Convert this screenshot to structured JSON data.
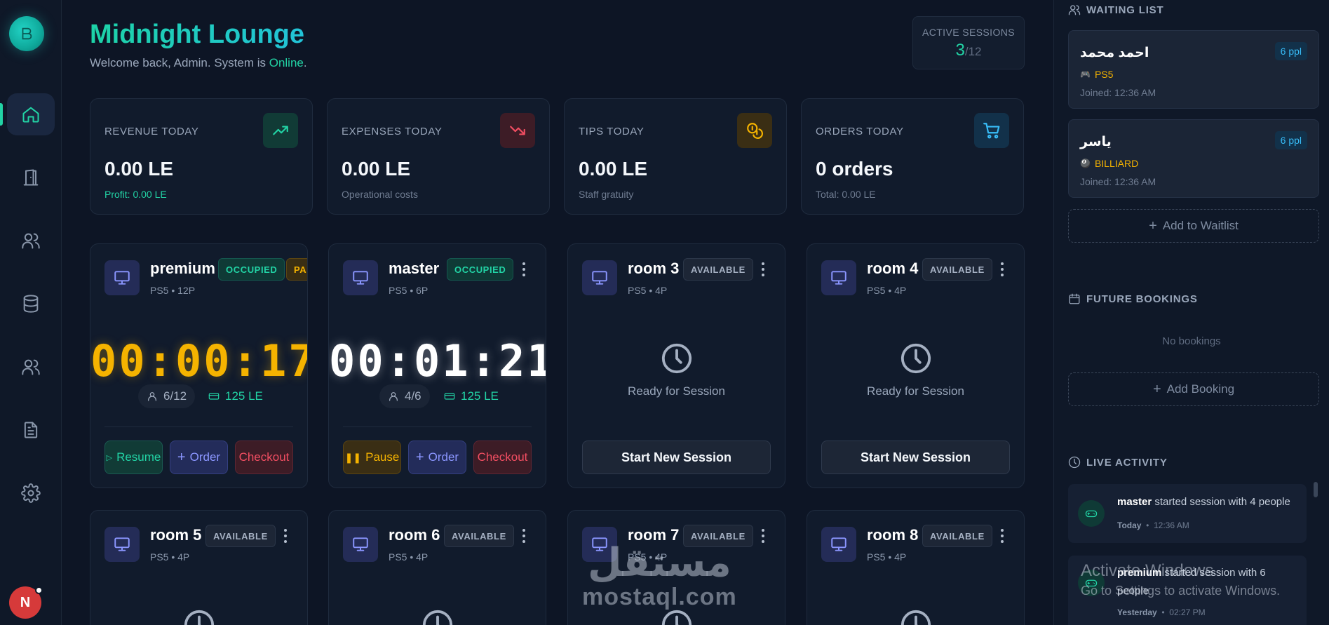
{
  "app": {
    "title": "Midnight Lounge",
    "welcome_prefix": "Welcome back, Admin. System is ",
    "status": "Online",
    "status_suffix": "."
  },
  "active_sessions": {
    "label": "ACTIVE SESSIONS",
    "current": "3",
    "total": "/12"
  },
  "sidebar": {
    "items": [
      "home-icon",
      "door-icon",
      "users-icon",
      "database-icon",
      "staff-icon",
      "document-icon",
      "settings-icon"
    ],
    "active": "home-icon",
    "avatar_letter": "N"
  },
  "stats": [
    {
      "label": "REVENUE TODAY",
      "value": "0.00 LE",
      "sub": "Profit: 0.00 LE",
      "icon": "trending-up-icon",
      "color": "#22d3a5"
    },
    {
      "label": "EXPENSES TODAY",
      "value": "0.00 LE",
      "sub": "Operational costs",
      "icon": "trending-down-icon",
      "color": "#f24e62"
    },
    {
      "label": "TIPS TODAY",
      "value": "0.00 LE",
      "sub": "Staff gratuity",
      "icon": "coins-icon",
      "color": "#f5b300"
    },
    {
      "label": "ORDERS TODAY",
      "value": "0 orders",
      "sub": "Total: 0.00 LE",
      "icon": "cart-icon",
      "color": "#38bdf8"
    }
  ],
  "rooms": [
    {
      "name": "premium",
      "meta": "PS5 • 12P",
      "badges": [
        "OCCUPIED",
        "PAUSED"
      ],
      "timer": "00:00:17",
      "people": "6/12",
      "price": "125 LE",
      "buttons": [
        "Resume",
        "Order",
        "Checkout"
      ]
    },
    {
      "name": "master",
      "meta": "PS5 • 6P",
      "badges": [
        "OCCUPIED"
      ],
      "timer": "00:01:21",
      "people": "4/6",
      "price": "125 LE",
      "buttons": [
        "Pause",
        "Order",
        "Checkout"
      ]
    },
    {
      "name": "room 3",
      "meta": "PS5 • 4P",
      "badge": "AVAILABLE",
      "ready": "Ready for Session",
      "start": "Start New Session"
    },
    {
      "name": "room 4",
      "meta": "PS5 • 4P",
      "badge": "AVAILABLE",
      "ready": "Ready for Session",
      "start": "Start New Session"
    },
    {
      "name": "room 5",
      "meta": "PS5 • 4P",
      "badge": "AVAILABLE"
    },
    {
      "name": "room 6",
      "meta": "PS5 • 4P",
      "badge": "AVAILABLE"
    },
    {
      "name": "room 7",
      "meta": "PS5 • 4P",
      "badge": "AVAILABLE"
    },
    {
      "name": "room 8",
      "meta": "PS5 • 4P",
      "badge": "AVAILABLE"
    }
  ],
  "waiting_list": {
    "title": "WAITING LIST",
    "entries": [
      {
        "name": "احمد محمد",
        "type": "PS5",
        "type_icon": "gamepad-icon",
        "joined": "Joined: 12:36 AM",
        "people": "6 ppl"
      },
      {
        "name": "ياسر",
        "type": "BILLIARD",
        "type_icon": "billiard-icon",
        "joined": "Joined: 12:36 AM",
        "people": "6 ppl"
      }
    ],
    "add_label": "Add to Waitlist"
  },
  "future_bookings": {
    "title": "FUTURE BOOKINGS",
    "empty": "No bookings",
    "add_label": "Add Booking"
  },
  "live_activity": {
    "title": "LIVE ACTIVITY",
    "items": [
      {
        "who": "master",
        "text": " started session with 4 people",
        "day": "Today",
        "time": "12:36 AM"
      },
      {
        "who": "premium",
        "text": " started session with 6 people",
        "day": "Yesterday",
        "time": "02:27 PM"
      }
    ]
  },
  "overlays": {
    "windows_line1": "Activate Windows",
    "windows_line2": "Go to Settings to activate Windows.",
    "watermark_ar": "مستقل",
    "watermark_en": "mostaql.com"
  }
}
